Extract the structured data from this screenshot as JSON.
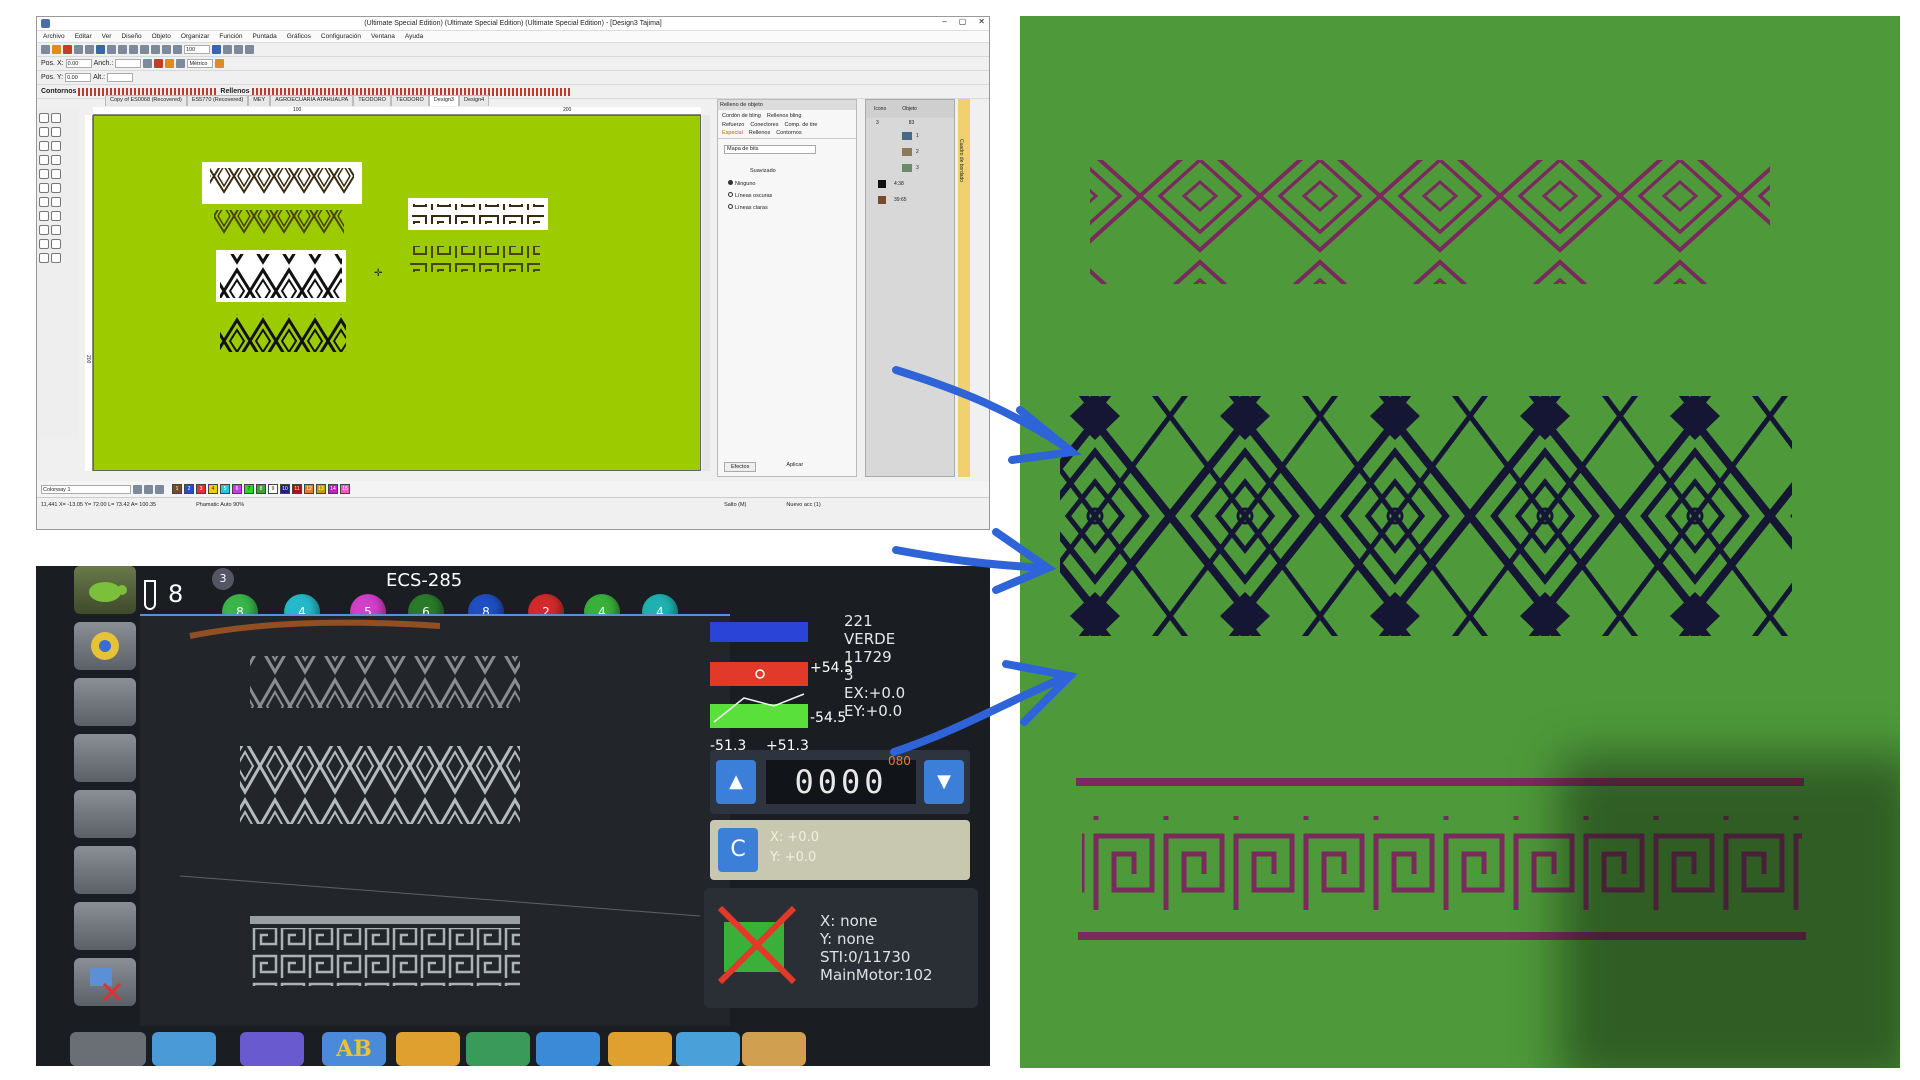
{
  "software": {
    "title": "(Ultimate Special Edition) (Ultimate Special Edition) (Ultimate Special Edition) - [Design3      Tajima]",
    "window_buttons": [
      "–",
      "▢",
      "✕"
    ],
    "menu": [
      "Archivo",
      "Editar",
      "Ver",
      "Diseño",
      "Objeto",
      "Organizar",
      "Función",
      "Puntada",
      "Gráficos",
      "Configuración",
      "Ventana",
      "Ayuda"
    ],
    "zoom_value": "100",
    "units_value": "Métrico",
    "pos_x_label": "Pos. X:",
    "pos_y_label": "Pos. Y:",
    "pos_x_value": "0.00",
    "pos_y_value": "0.00",
    "width_label": "Anch.:",
    "height_label": "Alt.:",
    "contornos_label": "Contornos",
    "rellenos_label": "Rellenos",
    "tabs": [
      "Copy of ES0068 (Recovered)",
      "ES5770 (Recovered)",
      "MEY",
      "AGROECUARIA ATAHUALPA",
      "TEODORO",
      "TEODORO",
      "Design3",
      "Design4"
    ],
    "ruler_marks": [
      "100",
      "200"
    ],
    "ruler_left_mark": "200",
    "panel": {
      "header": "Relleno de objeto",
      "tab_row1": [
        "Cordón de bling",
        "Rellenos bling"
      ],
      "tab_row2": [
        "Refuerzo",
        "Conectores",
        "Comp. de tire"
      ],
      "tab_row3": [
        "Especial",
        "Rellenos",
        "Contornos"
      ],
      "select_label": "Mapa de bits",
      "section_label": "Suavizado",
      "radio_options": [
        "Ninguno",
        "Líneas oscuras",
        "Líneas claras"
      ],
      "footer_buttons": [
        "Efectos",
        "Aplicar"
      ]
    },
    "objects_panel": {
      "headers": [
        "Icono",
        "Objeto"
      ],
      "rows": [
        {
          "num": "1",
          "label": ""
        },
        {
          "num": "2",
          "label": ""
        },
        {
          "num": "3",
          "label": ""
        },
        {
          "num": "4:38",
          "label": ""
        },
        {
          "num": "39:65",
          "label": ""
        }
      ],
      "column_vals": [
        "3",
        "83"
      ]
    },
    "side_tab_label": "Cuadro de bordado",
    "colorway_label": "Colorway 1",
    "palette": [
      {
        "n": "1",
        "color": "#7a4b2a"
      },
      {
        "n": "2",
        "color": "#2a4bd0"
      },
      {
        "n": "3",
        "color": "#e03030"
      },
      {
        "n": "4",
        "color": "#f0d000"
      },
      {
        "n": "5",
        "color": "#30c0e0"
      },
      {
        "n": "6",
        "color": "#c040e0"
      },
      {
        "n": "7",
        "color": "#30d030"
      },
      {
        "n": "8",
        "color": "#40a040"
      },
      {
        "n": "9",
        "color": "#ffffff"
      },
      {
        "n": "10",
        "color": "#202080"
      },
      {
        "n": "11",
        "color": "#b01010"
      },
      {
        "n": "12",
        "color": "#e08020"
      },
      {
        "n": "13",
        "color": "#c0a000"
      },
      {
        "n": "14",
        "color": "#c020c0"
      },
      {
        "n": "15",
        "color": "#e060c0"
      }
    ],
    "status": {
      "coords": "11,441     X= -13.05  Y= 72.00  L= 73.42  A= 100.35",
      "mode": "Phamatic Auto 90%",
      "jump": "Salto (M)",
      "new_stitch": "Nuevo acc (1)"
    },
    "canvas_color": "#9ccc00"
  },
  "machine": {
    "model": "ECS-285",
    "needle_count": "8",
    "badge": "3",
    "needles": [
      {
        "n": "8",
        "color": "#39b54a"
      },
      {
        "n": "4",
        "color": "#25b8c8"
      },
      {
        "n": "5",
        "color": "#d040c8"
      },
      {
        "n": "6",
        "color": "#2a7a2a"
      },
      {
        "n": "8",
        "color": "#1f4fc0"
      },
      {
        "n": "2",
        "color": "#d22a2a"
      },
      {
        "n": "4",
        "color": "#3ab03a"
      },
      {
        "n": "4",
        "color": "#1fb0b0"
      }
    ],
    "info_lines": [
      "221",
      "VERDE",
      "11729",
      "3",
      "EX:+0.0",
      "EY:+0.0"
    ],
    "axis": {
      "top": "+54.5",
      "bottom": "-54.5",
      "left": "-51.3",
      "right": "+51.3"
    },
    "counter": {
      "value": "0000",
      "small": "080",
      "up": "▲",
      "down": "▼"
    },
    "c_button": "C",
    "c_values": [
      "X:   +0.0",
      "Y:   +0.0"
    ],
    "status_lines": [
      "X: none",
      "Y: none",
      "STI:0/11730",
      "MainMotor:102"
    ],
    "bottom_text": "AB"
  },
  "colors": {
    "arrow": "#2f64d8",
    "canvas_green": "#9ccc00",
    "fabric_green": "#4e9a3a",
    "thread_purple": "#7b2a5e",
    "thread_navy": "#141634"
  }
}
